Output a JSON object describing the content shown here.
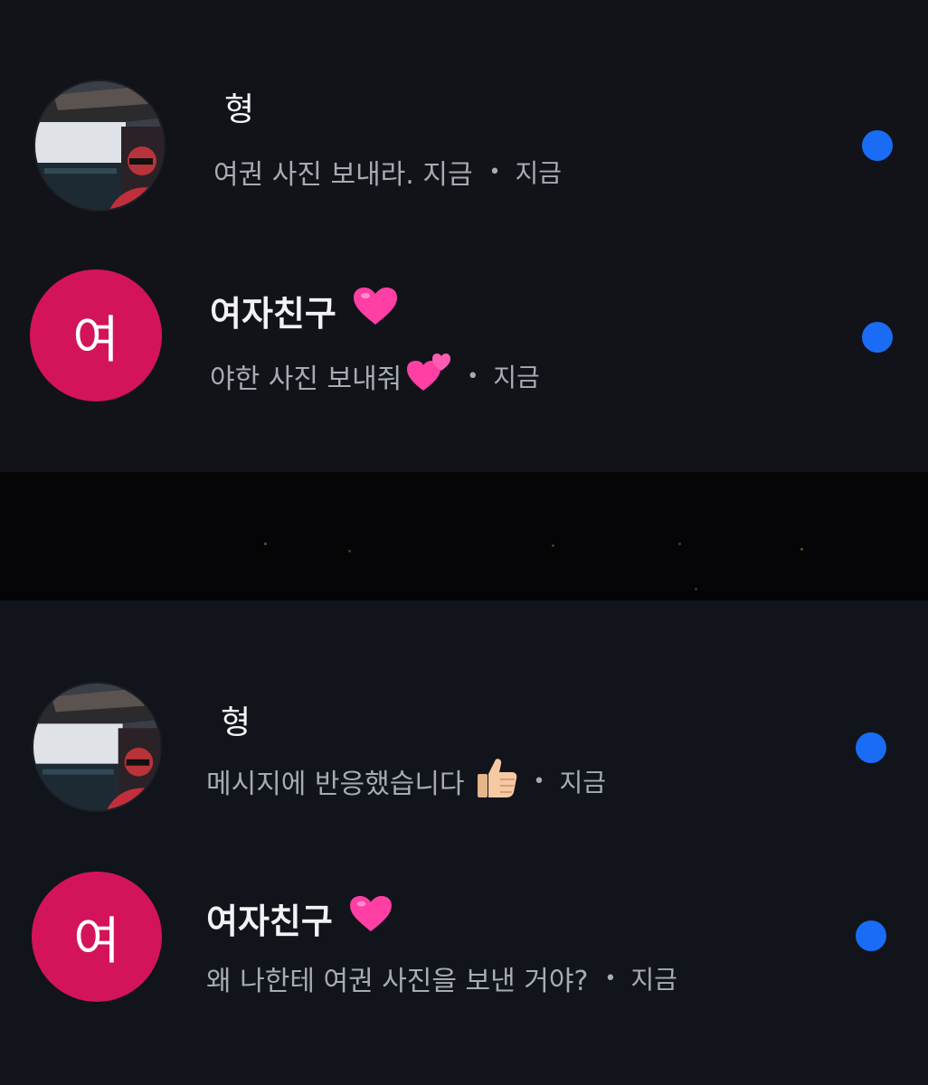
{
  "conversations": [
    {
      "name": "형",
      "preview": "여권 사진 보내라. 지금",
      "time": "지금",
      "separator": "•",
      "avatar_type": "photo",
      "unread": true
    },
    {
      "name": "여자친구",
      "avatar_letter": "여",
      "preview": "야한 사진 보내줘",
      "time": "지금",
      "separator": "•",
      "avatar_type": "letter",
      "unread": true,
      "name_emoji": "pink-heart-icon",
      "preview_emoji": "two-hearts-icon"
    },
    {
      "name": "형",
      "preview": "메시지에 반응했습니다",
      "time": "지금",
      "separator": "•",
      "avatar_type": "photo",
      "unread": true,
      "preview_emoji": "thumbs-up-icon"
    },
    {
      "name": "여자친구",
      "avatar_letter": "여",
      "preview": "왜 나한테 여권 사진을 보낸 거야?",
      "time": "지금",
      "separator": "•",
      "avatar_type": "letter",
      "unread": true,
      "name_emoji": "pink-heart-icon"
    }
  ],
  "colors": {
    "background": "#111319",
    "avatar_letter_bg": "#d4145a",
    "unread_dot": "#1a6cf5",
    "name_text": "#f2f2f4",
    "preview_text": "#a7abb4"
  }
}
